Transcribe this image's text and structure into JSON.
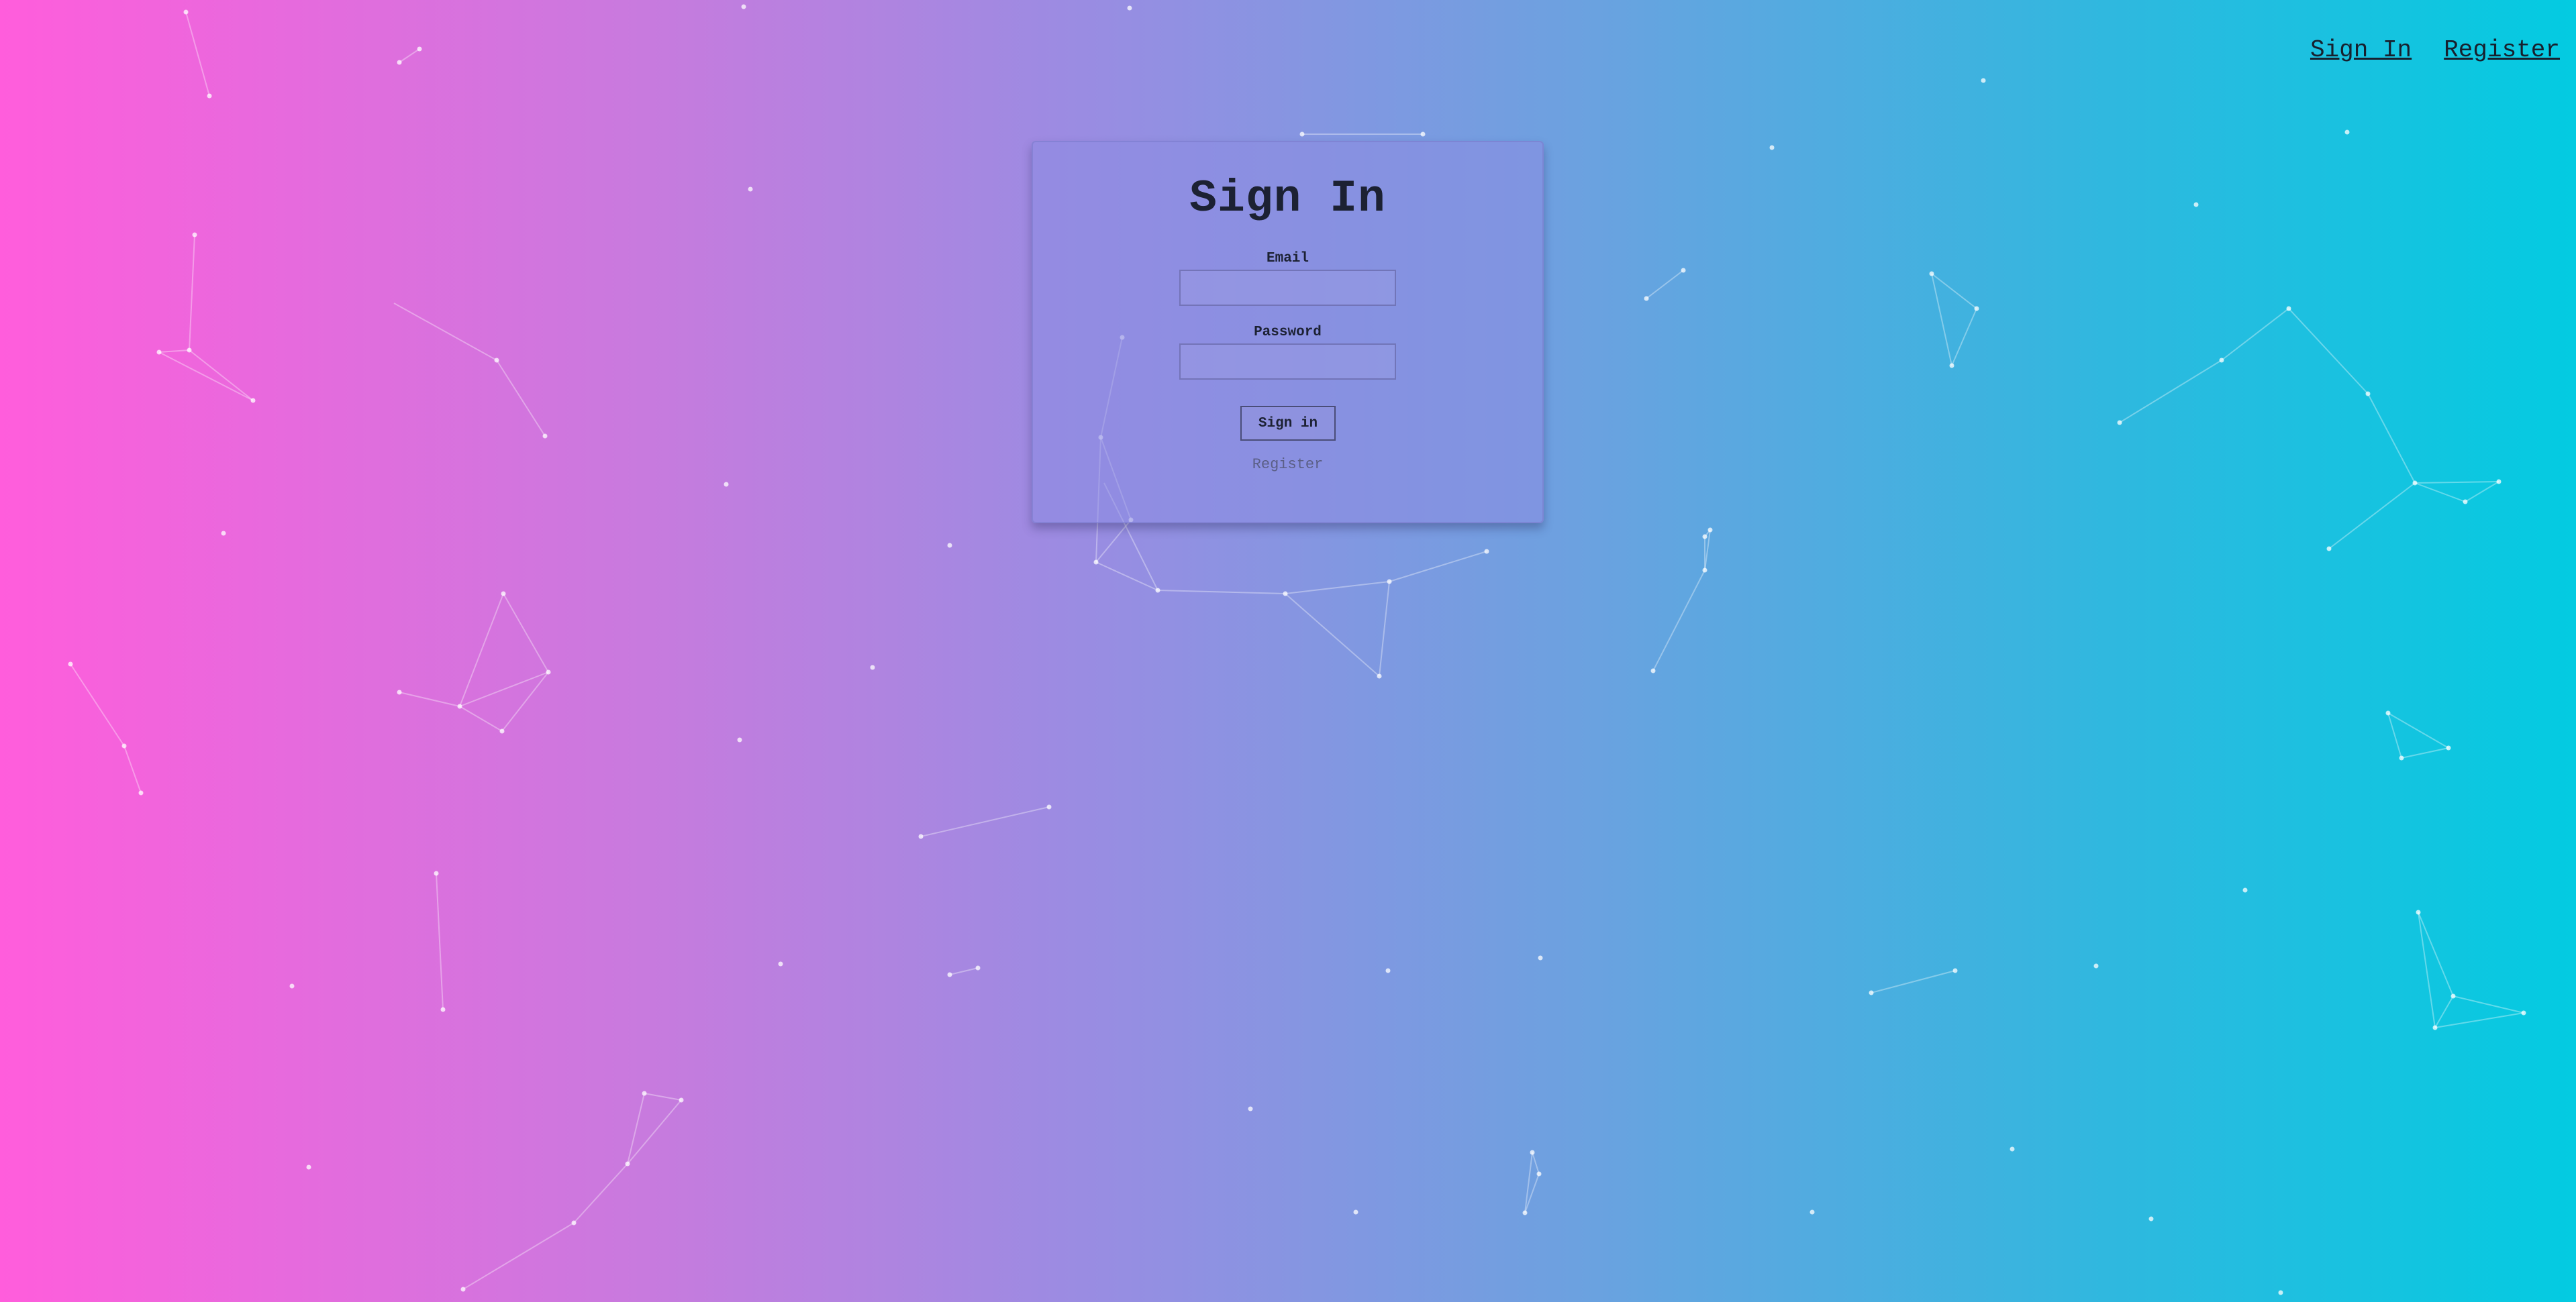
{
  "nav": {
    "signin_label": "Sign In",
    "register_label": "Register"
  },
  "form": {
    "title": "Sign In",
    "email_label": "Email",
    "email_value": "",
    "password_label": "Password",
    "password_value": "",
    "submit_label": "Sign in",
    "register_label": "Register"
  },
  "colors": {
    "gradient_left": "#ff5ddc",
    "gradient_right": "#03cbe1",
    "text": "#17202e"
  },
  "background": {
    "decoration": "particle-network"
  }
}
